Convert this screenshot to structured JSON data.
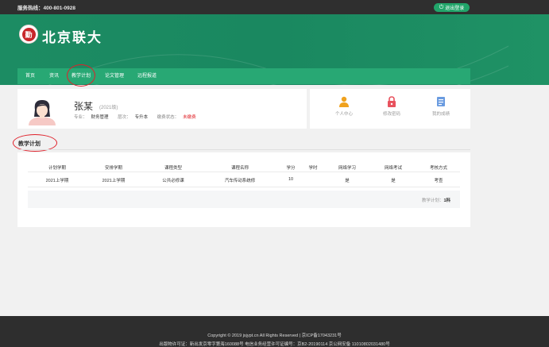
{
  "topbar": {
    "hotline": "服务热线：400-801-0928",
    "logout_label": "退出登录"
  },
  "header": {
    "logo_char": "勤",
    "school_name": "北京联大"
  },
  "nav": {
    "items": [
      "首页",
      "资讯",
      "教学计划",
      "论文管理",
      "远程报道"
    ]
  },
  "profile": {
    "name": "张某",
    "year": "(2021级)",
    "major_label": "专业：",
    "major": "财务管理",
    "level_label": "层次：",
    "level": "专升本",
    "fee_label": "缴费状态：",
    "fee_status": "未缴费"
  },
  "quick_links": [
    {
      "label": "个人中心",
      "icon": "person-icon",
      "color": "#f0a21e"
    },
    {
      "label": "修改密码",
      "icon": "lock-icon",
      "color": "#e8525e"
    },
    {
      "label": "我的成绩",
      "icon": "score-icon",
      "color": "#6a9be0"
    }
  ],
  "section": {
    "title": "教学计划"
  },
  "plan": {
    "headers": [
      "计划学期",
      "安排学期",
      "课程类型",
      "课程名称",
      "学分",
      "学时",
      "网络学习",
      "网络考试",
      "考核方式"
    ],
    "rows": [
      [
        "2021上学期",
        "2021上学期",
        "公共必修课",
        "汽车传动系统修",
        "10",
        "",
        "是",
        "是",
        "考查"
      ]
    ],
    "summary_label": "教学计划：",
    "summary_value": "1科"
  },
  "footer": {
    "line1": "Copyright © 2019 jsjypt.cn All Rights Reserved | 京ICP备17043231号",
    "line2": "出版物许可证：新出发京零字第海160088号 电信业务经营许可证编号：京B2-20190114 京公网安备 11010802031480号"
  },
  "colors": {
    "header_green": "#1c8c63",
    "nav_green": "#28a874",
    "accent_red": "#e0242a"
  }
}
